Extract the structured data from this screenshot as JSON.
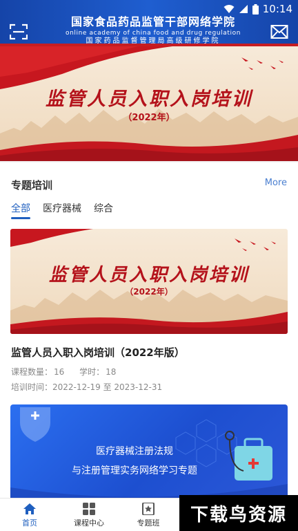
{
  "status": {
    "time": "10:14"
  },
  "header": {
    "title_cn": "国家食品药品监管干部网络学院",
    "title_en": "online academy of china food and drug regulation",
    "subtitle": "国家药品监督管理局高级研修学院",
    "left_icon": "scan-icon",
    "right_icon": "mail-icon"
  },
  "banner": {
    "title": "监管人员入职入岗培训",
    "year": "（2022年）"
  },
  "section": {
    "title": "专题培训",
    "more": "More",
    "tabs": [
      {
        "label": "全部"
      },
      {
        "label": "医疗器械"
      },
      {
        "label": "综合"
      }
    ]
  },
  "courses": [
    {
      "banner_title": "监管人员入职入岗培训",
      "banner_year": "（2022年）",
      "name": "监管人员入职入岗培训（2022年版）",
      "count_label": "课程数量：",
      "count": "16",
      "hours_label": "学时：",
      "hours": "18",
      "date_label": "培训时间：",
      "date_range": "2022-12-19 至 2023-12-31"
    },
    {
      "line1": "医疗器械注册法规",
      "line2": "与注册管理实务网络学习专题"
    }
  ],
  "nav": [
    {
      "label": "首页",
      "icon": "home-icon"
    },
    {
      "label": "课程中心",
      "icon": "grid-icon"
    },
    {
      "label": "专题班",
      "icon": "star-book-icon"
    }
  ],
  "watermark": "下载鸟资源",
  "colors": {
    "primary": "#1f5fbf",
    "header": "#1a4fb8",
    "banner_red": "#b4121b"
  }
}
